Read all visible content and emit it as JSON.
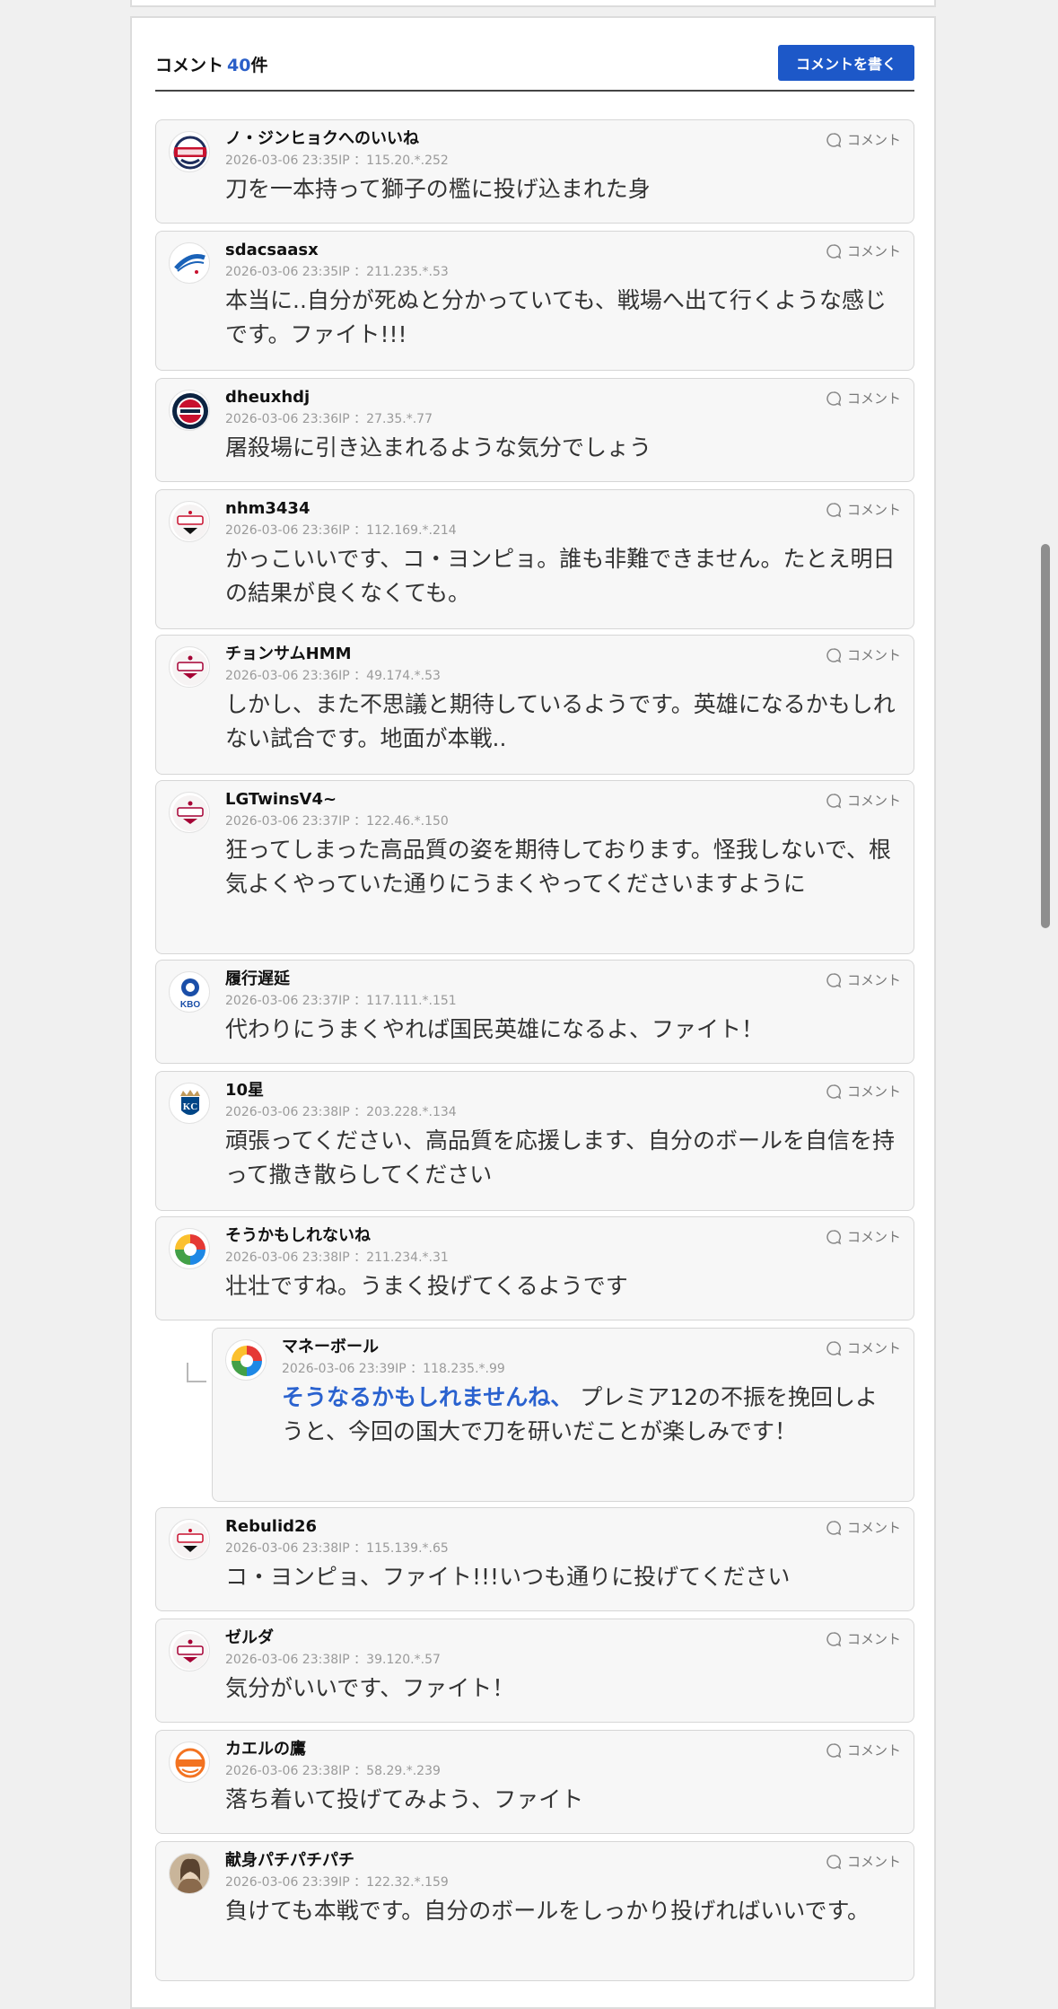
{
  "header": {
    "title": "コメント",
    "count": "40",
    "count_unit": "件",
    "write_button": "コメントを書く"
  },
  "comment_button_label": "コメント",
  "comments": [
    {
      "name": "ノ・ジンヒョクへのいいね",
      "meta": "2026-03-06 23:35IP ：115.20.*.252",
      "text": "刀を一本持って獅子の檻に投げ込まれた身",
      "avatar": "bears-logo"
    },
    {
      "name": "sdacsaasx",
      "meta": "2026-03-06 23:35IP ：211.235.*.53",
      "text": "本当に..自分が死ぬと分かっていても、戦場へ出て行くような感じです。ファイト!!!",
      "avatar": "lions-logo"
    },
    {
      "name": "dheuxhdj",
      "meta": "2026-03-06 23:36IP ：27.35.*.77",
      "text": "屠殺場に引き込まれるような気分でしょう",
      "avatar": "twins-logo"
    },
    {
      "name": "nhm3434",
      "meta": "2026-03-06 23:36IP ：112.169.*.214",
      "text": "かっこいいです、コ・ヨンピョ。誰も非難できません。たとえ明日の結果が良くなくても。",
      "avatar": "tigers-logo"
    },
    {
      "name": "チョンサムHMM",
      "meta": "2026-03-06 23:36IP ：49.174.*.53",
      "text": "しかし、また不思議と期待しているようです。英雄になるかもしれない試合です。地面が本戦..",
      "avatar": "lg-twins-logo"
    },
    {
      "name": "LGTwinsV4~",
      "meta": "2026-03-06 23:37IP ：122.46.*.150",
      "text": "狂ってしまった高品質の姿を期待しております。怪我しないで、根気よくやっていた通りにうまくやってくださいますように",
      "avatar": "lg-twins-logo"
    },
    {
      "name": "履行遅延",
      "meta": "2026-03-06 23:37IP ：117.111.*.151",
      "text": "代わりにうまくやれば国民英雄になるよ、ファイト！",
      "avatar": "kbo-logo",
      "avatar_text": "KBO"
    },
    {
      "name": "10星",
      "meta": "2026-03-06 23:38IP ：203.228.*.134",
      "text": "頑張ってください、高品質を応援します、自分のボールを自信を持って撒き散らしてください",
      "avatar": "kc-logo",
      "avatar_text": "KC"
    },
    {
      "name": "そうかもしれないね",
      "meta": "2026-03-06 23:38IP ：211.234.*.31",
      "text": "壮壮ですね。うまく投げてくるようです",
      "avatar": "wbc-logo"
    },
    {
      "name": "マネーボール",
      "meta": "2026-03-06 23:39IP ：118.235.*.99",
      "mention": "そうなるかもしれませんね、",
      "text": " プレミア12の不振を挽回しようと、今回の国大で刀を研いだことが楽しみです！",
      "avatar": "wbc-logo",
      "reply": true
    },
    {
      "name": "Rebulid26",
      "meta": "2026-03-06 23:38IP ：115.139.*.65",
      "text": "コ・ヨンピョ、ファイト!!!いつも通りに投げてください",
      "avatar": "tigers-logo"
    },
    {
      "name": "ゼルダ",
      "meta": "2026-03-06 23:38IP ：39.120.*.57",
      "text": "気分がいいです、ファイト！",
      "avatar": "lg-twins-logo"
    },
    {
      "name": "カエルの鷹",
      "meta": "2026-03-06 23:38IP ：58.29.*.239",
      "text": "落ち着いて投げてみよう、ファイト",
      "avatar": "eagles-logo"
    },
    {
      "name": "献身パチパチパチ",
      "meta": "2026-03-06 23:39IP ：122.32.*.159",
      "text": "負けても本戦です。自分のボールをしっかり投げればいいです。",
      "avatar": "photo-avatar"
    }
  ]
}
